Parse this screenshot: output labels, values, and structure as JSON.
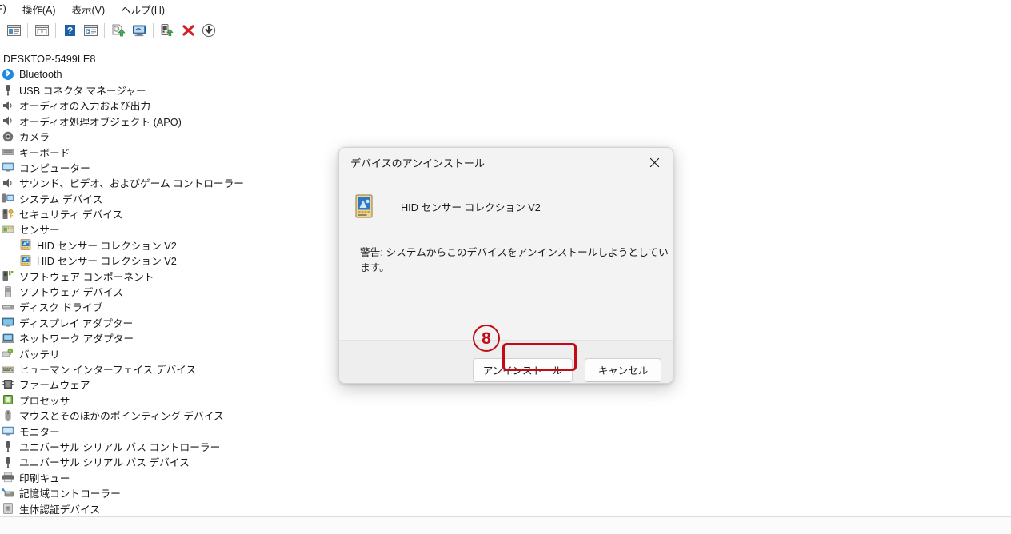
{
  "menubar": {
    "items": [
      {
        "label": "F)",
        "name": "menu-file-clipped"
      },
      {
        "label": "操作(A)",
        "name": "menu-action"
      },
      {
        "label": "表示(V)",
        "name": "menu-view"
      },
      {
        "label": "ヘルプ(H)",
        "name": "menu-help"
      }
    ]
  },
  "toolbar": {
    "buttons": [
      {
        "icon": "properties-icon",
        "name": "toolbar-properties"
      },
      {
        "icon": "help-window-icon",
        "name": "toolbar-help-window"
      },
      {
        "icon": "help-icon",
        "name": "toolbar-help"
      },
      {
        "icon": "properties-window-icon",
        "name": "toolbar-properties-window"
      },
      {
        "icon": "update-driver-icon",
        "name": "toolbar-update-driver"
      },
      {
        "icon": "scan-hardware-icon",
        "name": "toolbar-scan-hardware"
      },
      {
        "icon": "enable-device-icon",
        "name": "toolbar-enable-device"
      },
      {
        "icon": "uninstall-device-icon",
        "name": "toolbar-uninstall-device"
      },
      {
        "icon": "disable-device-icon",
        "name": "toolbar-disable-device"
      }
    ]
  },
  "tree": {
    "root": {
      "label": "DESKTOP-5499LE8",
      "icon": "computer-icon"
    },
    "items": [
      {
        "label": "Bluetooth",
        "icon": "bluetooth-icon",
        "level": 1
      },
      {
        "label": "USB コネクタ マネージャー",
        "icon": "usb-icon",
        "level": 1
      },
      {
        "label": "オーディオの入力および出力",
        "icon": "audio-icon",
        "level": 1
      },
      {
        "label": "オーディオ処理オブジェクト (APO)",
        "icon": "audio-icon",
        "level": 1
      },
      {
        "label": "カメラ",
        "icon": "camera-icon",
        "level": 1
      },
      {
        "label": "キーボード",
        "icon": "keyboard-icon",
        "level": 1
      },
      {
        "label": "コンピューター",
        "icon": "computer-icon",
        "level": 1
      },
      {
        "label": "サウンド、ビデオ、およびゲーム コントローラー",
        "icon": "audio-icon",
        "level": 1
      },
      {
        "label": "システム デバイス",
        "icon": "system-device-icon",
        "level": 1
      },
      {
        "label": "セキュリティ デバイス",
        "icon": "security-device-icon",
        "level": 1
      },
      {
        "label": "センサー",
        "icon": "sensor-icon",
        "level": 1
      },
      {
        "label": "HID センサー コレクション V2",
        "icon": "hid-sensor-icon",
        "level": 2
      },
      {
        "label": "HID センサー コレクション V2",
        "icon": "hid-sensor-icon",
        "level": 2
      },
      {
        "label": "ソフトウェア コンポーネント",
        "icon": "software-component-icon",
        "level": 1
      },
      {
        "label": "ソフトウェア デバイス",
        "icon": "software-device-icon",
        "level": 1
      },
      {
        "label": "ディスク ドライブ",
        "icon": "disk-drive-icon",
        "level": 1
      },
      {
        "label": "ディスプレイ アダプター",
        "icon": "display-adapter-icon",
        "level": 1
      },
      {
        "label": "ネットワーク アダプター",
        "icon": "network-adapter-icon",
        "level": 1
      },
      {
        "label": "バッテリ",
        "icon": "battery-icon",
        "level": 1
      },
      {
        "label": "ヒューマン インターフェイス デバイス",
        "icon": "hid-icon",
        "level": 1
      },
      {
        "label": "ファームウェア",
        "icon": "firmware-icon",
        "level": 1
      },
      {
        "label": "プロセッサ",
        "icon": "processor-icon",
        "level": 1
      },
      {
        "label": "マウスとそのほかのポインティング デバイス",
        "icon": "mouse-icon",
        "level": 1
      },
      {
        "label": "モニター",
        "icon": "monitor-icon",
        "level": 1
      },
      {
        "label": "ユニバーサル シリアル バス コントローラー",
        "icon": "usb-icon",
        "level": 1
      },
      {
        "label": "ユニバーサル シリアル バス デバイス",
        "icon": "usb-icon",
        "level": 1
      },
      {
        "label": "印刷キュー",
        "icon": "print-queue-icon",
        "level": 1
      },
      {
        "label": "記憶域コントローラー",
        "icon": "storage-controller-icon",
        "level": 1
      },
      {
        "label": "生体認証デバイス",
        "icon": "biometric-device-icon",
        "level": 1
      }
    ]
  },
  "dialog": {
    "title": "デバイスのアンインストール",
    "close_icon": "close-icon",
    "device_icon": "hid-sensor-icon",
    "device_name": "HID センサー コレクション V2",
    "warning": "警告: システムからこのデバイスをアンインストールしようとしています。",
    "uninstall_label": "アンインストール",
    "cancel_label": "キャンセル"
  },
  "annotation": {
    "step_number": "8",
    "color": "#c30b16"
  }
}
